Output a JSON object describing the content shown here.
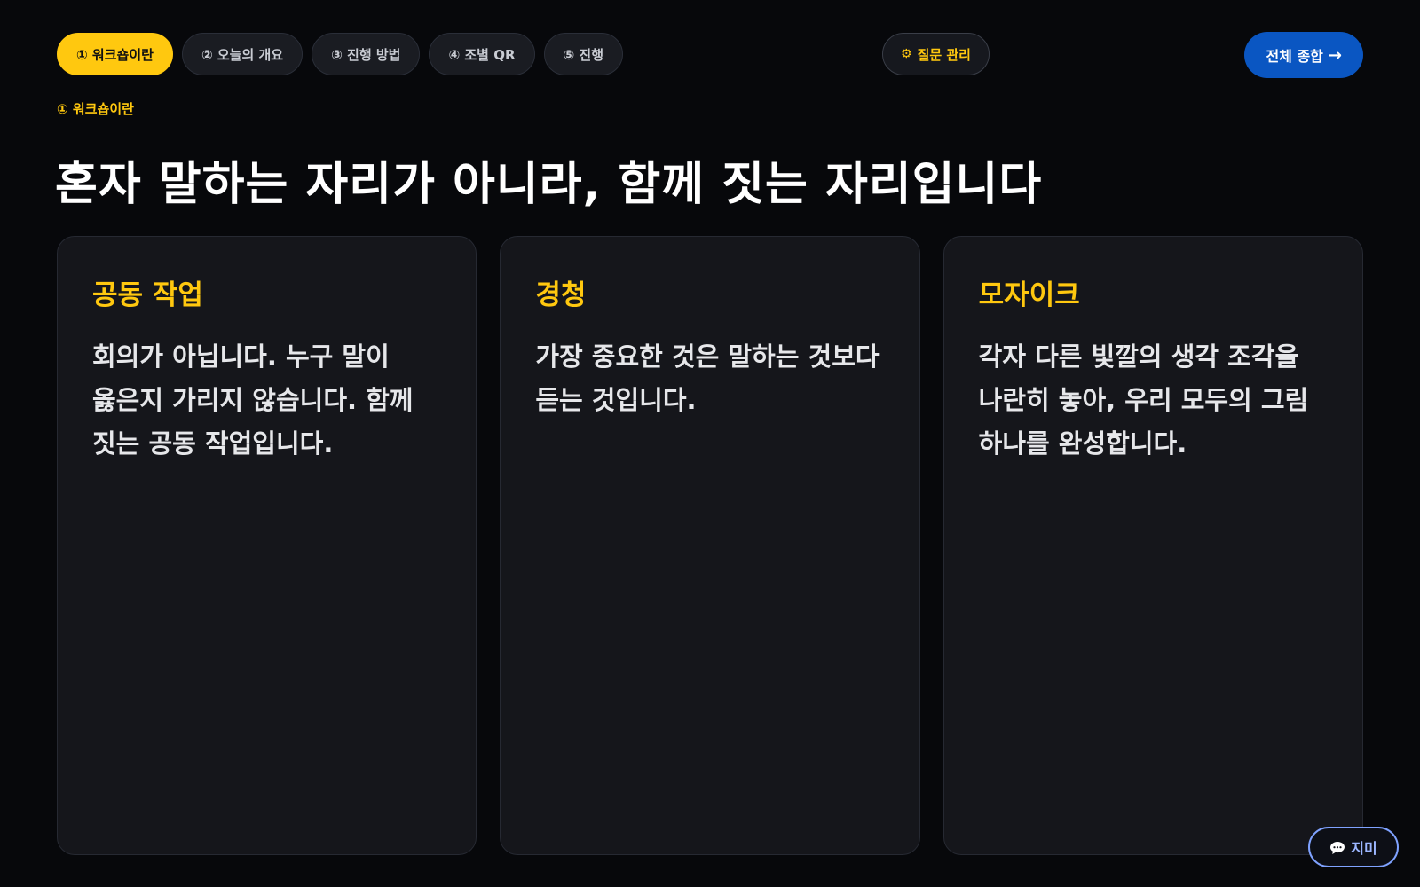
{
  "nav": {
    "tabs": [
      {
        "label": "① 워크숍이란",
        "active": true
      },
      {
        "label": "② 오늘의 개요",
        "active": false
      },
      {
        "label": "③ 진행 방법",
        "active": false
      },
      {
        "label": "④ 조별 QR",
        "active": false
      },
      {
        "label": "⑤ 진행",
        "active": false
      }
    ],
    "manage": {
      "icon": "gear-icon",
      "glyph": "⚙",
      "label": "질문 관리"
    },
    "summary": {
      "label": "전체 종합",
      "arrow": "→"
    }
  },
  "section": {
    "label": "① 워크숍이란",
    "title": "혼자 말하는 자리가 아니라, 함께 짓는 자리입니다"
  },
  "cards": [
    {
      "title": "공동 작업",
      "body": "회의가 아닙니다. 누구 말이 옳은지 가리지 않습니다. 함께 짓는 공동 작업입니다."
    },
    {
      "title": "경청",
      "body": "가장 중요한 것은 말하는 것보다 듣는 것입니다."
    },
    {
      "title": "모자이크",
      "body": "각자 다른 빛깔의 생각 조각을 나란히 놓아, 우리 모두의 그림 하나를 완성합니다."
    }
  ],
  "assistant": {
    "icon": "chat-bubble-icon",
    "label": "지미"
  },
  "colors": {
    "accent": "#ffc80f",
    "primary": "#0a56c2",
    "background": "#07080b",
    "card": "#15161b",
    "assistant_border": "#7fa2ff"
  }
}
